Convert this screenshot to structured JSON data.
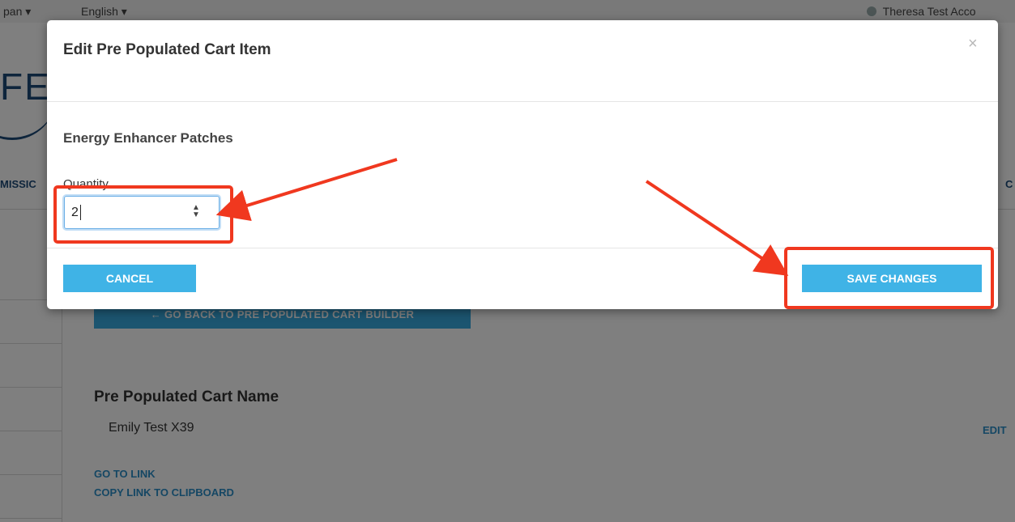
{
  "background": {
    "topbar": {
      "lang_left": "pan ▾",
      "language": "English ▾",
      "user_name": "Theresa Test Acco"
    },
    "logo_fragment": "FE",
    "nav_left_fragment": "MISSIC",
    "nav_right_fragment": "C",
    "go_back_button": "← GO BACK TO PRE POPULATED CART BUILDER",
    "cart_name_heading": "Pre Populated Cart Name",
    "cart_name_value": "Emily Test X39",
    "edit_link": "EDIT",
    "go_to_link": "GO TO LINK",
    "copy_link": "COPY LINK TO CLIPBOARD"
  },
  "modal": {
    "title": "Edit Pre Populated Cart Item",
    "close_symbol": "×",
    "product_name": "Energy Enhancer Patches",
    "quantity_label": "Quantity",
    "quantity_value": "2",
    "spinner_symbol": "▲\n▼",
    "cancel_label": "CANCEL",
    "save_label": "SAVE CHANGES"
  },
  "colors": {
    "primary_button": "#3fb3e6",
    "annotation_red": "#f0381f",
    "link_blue": "#2a8ec9"
  }
}
